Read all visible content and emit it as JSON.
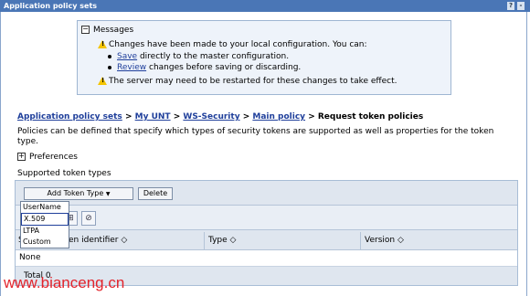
{
  "window": {
    "title": "Application policy sets",
    "help_label": "?",
    "minimize_label": "-"
  },
  "messages": {
    "header": "Messages",
    "line1": "Changes have been made to your local configuration. You can:",
    "save_link": "Save",
    "save_rest": "directly to the master configuration.",
    "review_link": "Review",
    "review_rest": "changes before saving or discarding.",
    "line4": "The server may need to be restarted for these changes to take effect."
  },
  "breadcrumb": {
    "items": [
      "Application policy sets",
      "My UNT",
      "WS-Security",
      "Main policy"
    ],
    "separator": ">",
    "current": "Request token policies"
  },
  "description": "Policies can be defined that specify which types of security tokens are supported as well as properties for the token type.",
  "preferences_label": "Preferences",
  "supported_label": "Supported token types",
  "toolbar": {
    "add_token_type": "Add Token Type",
    "add_token_caret": "▼",
    "delete": "Delete"
  },
  "dropdown": {
    "options": [
      "UserName",
      "X.509",
      "LTPA",
      "Custom"
    ]
  },
  "table": {
    "select_col": "S",
    "columns": [
      "en identifier",
      "Type",
      "Version"
    ],
    "sort_icon": "◇",
    "rows": [
      "None"
    ],
    "total": "Total 0"
  },
  "watermark": "www.bianceng.cn"
}
